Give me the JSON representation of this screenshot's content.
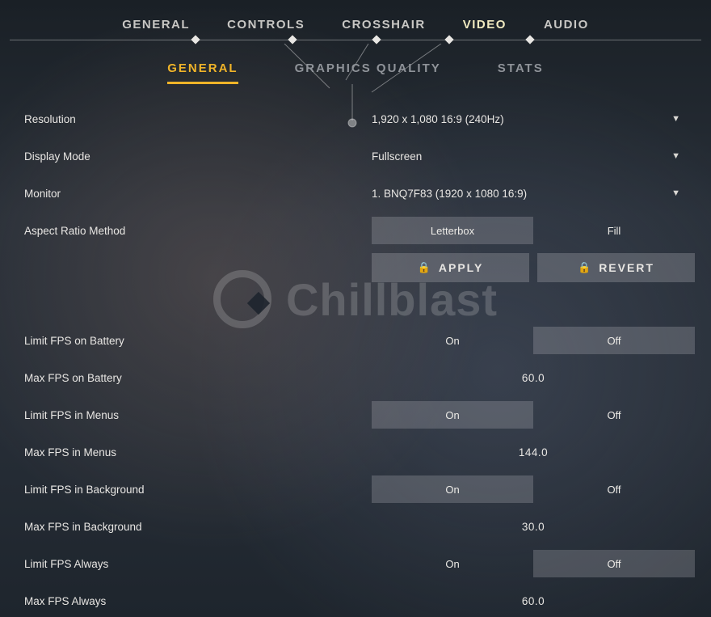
{
  "topnav": {
    "tabs": [
      "GENERAL",
      "CONTROLS",
      "CROSSHAIR",
      "VIDEO",
      "AUDIO"
    ],
    "active_index": 3
  },
  "subnav": {
    "tabs": [
      "GENERAL",
      "GRAPHICS QUALITY",
      "STATS"
    ],
    "active_index": 0
  },
  "dropdowns": {
    "resolution": {
      "label": "Resolution",
      "value": "1,920 x 1,080 16:9 (240Hz)"
    },
    "display_mode": {
      "label": "Display Mode",
      "value": "Fullscreen"
    },
    "monitor": {
      "label": "Monitor",
      "value": "1. BNQ7F83 (1920 x  1080 16:9)"
    }
  },
  "aspect_ratio": {
    "label": "Aspect Ratio Method",
    "options": [
      "Letterbox",
      "Fill"
    ],
    "selected_index": 0
  },
  "actions": {
    "apply": "APPLY",
    "revert": "REVERT"
  },
  "fps": {
    "limit_battery": {
      "label": "Limit FPS on Battery",
      "options": [
        "On",
        "Off"
      ],
      "selected_index": 1
    },
    "max_battery": {
      "label": "Max FPS on Battery",
      "value": "60.0"
    },
    "limit_menus": {
      "label": "Limit FPS in Menus",
      "options": [
        "On",
        "Off"
      ],
      "selected_index": 0
    },
    "max_menus": {
      "label": "Max FPS in Menus",
      "value": "144.0"
    },
    "limit_bg": {
      "label": "Limit FPS in Background",
      "options": [
        "On",
        "Off"
      ],
      "selected_index": 0
    },
    "max_bg": {
      "label": "Max FPS in Background",
      "value": "30.0"
    },
    "limit_always": {
      "label": "Limit FPS Always",
      "options": [
        "On",
        "Off"
      ],
      "selected_index": 1
    },
    "max_always": {
      "label": "Max FPS Always",
      "value": "60.0"
    }
  },
  "watermark": "Chillblast"
}
